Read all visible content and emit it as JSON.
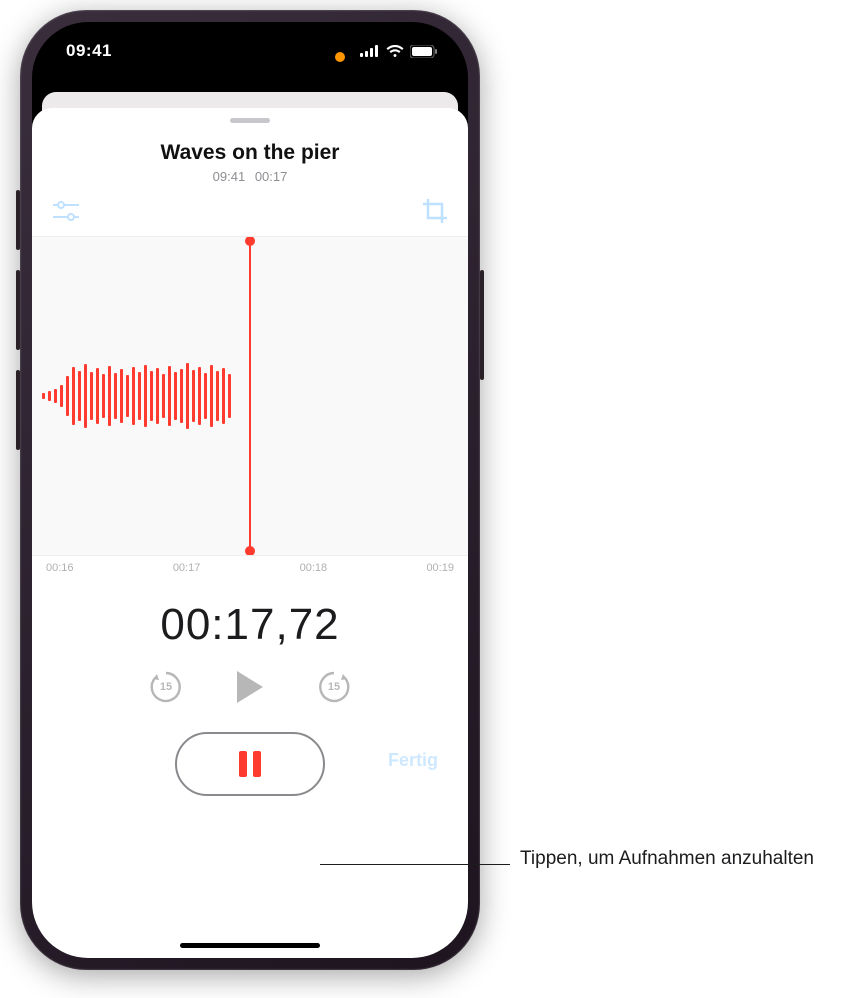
{
  "statusbar": {
    "time": "09:41"
  },
  "recording": {
    "title": "Waves on the pier",
    "timestamp": "09:41",
    "duration": "00:17"
  },
  "timeline": {
    "ticks": [
      "00:16",
      "00:17",
      "00:18",
      "00:19"
    ]
  },
  "elapsed": "00:17,72",
  "skip": {
    "back": "15",
    "forward": "15"
  },
  "done_label": "Fertig",
  "callout": "Tippen, um Aufnahmen anzuhalten"
}
